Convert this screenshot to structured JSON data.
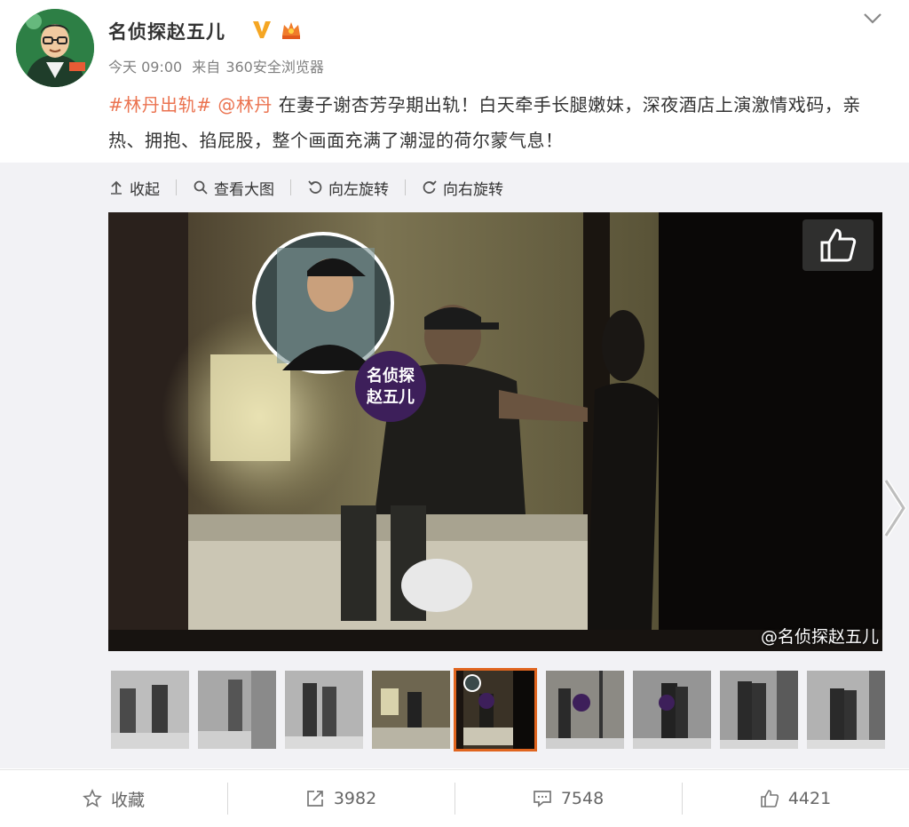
{
  "author": {
    "name": "名侦探赵五儿",
    "avatar_icon": "cartoon-avatar-icon",
    "verified_icon": "verified-v-icon",
    "vip_icon": "vip-crown-icon"
  },
  "meta": {
    "time": "今天 09:00",
    "source_prefix": "来自",
    "source": "360安全浏览器"
  },
  "post": {
    "hashtag": "#林丹出轨#",
    "mention": "@林丹",
    "text": " 在妻子谢杏芳孕期出轨！白天牵手长腿嫩妹，深夜酒店上演激情戏码，亲热、拥抱、掐屁股，整个画面充满了潮湿的荷尔蒙气息！"
  },
  "toolbar": {
    "collapse": "收起",
    "view_large": "查看大图",
    "rotate_left": "向左旋转",
    "rotate_right": "向右旋转"
  },
  "photo": {
    "watermark": "@名侦探赵五儿",
    "logo_text": "名侦探赵五儿"
  },
  "thumbnails": {
    "count": 9,
    "active_index": 4
  },
  "actions": {
    "favorite": "收藏",
    "repost": "3982",
    "comment": "7548",
    "like": "4421"
  },
  "colors": {
    "link": "#eb7350",
    "active_thumb": "#e0651f",
    "verified": "#f5a623"
  }
}
